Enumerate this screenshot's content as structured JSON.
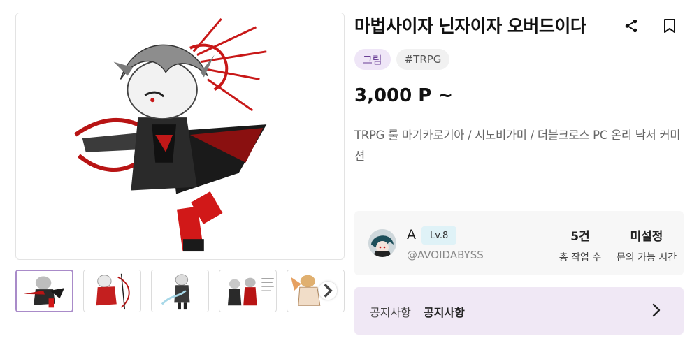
{
  "product": {
    "title": "마법사이자 닌자이자 오버드이다",
    "price": "3,000 P ~",
    "description": "TRPG 룰 마기카로기아 / 시노비가미 / 더블크로스 PC 온리 낙서 커미션",
    "tags": [
      {
        "label": "그림"
      },
      {
        "label": "#TRPG"
      }
    ]
  },
  "actions": {
    "share_icon": "share-icon",
    "bookmark_icon": "bookmark-icon"
  },
  "seller": {
    "name": "A",
    "level": "Lv.8",
    "handle": "@AVOIDABYSS",
    "stats": {
      "works_value": "5건",
      "works_label": "총 작업 수",
      "time_value": "미설정",
      "time_label": "문의 가능 시간"
    }
  },
  "notice": {
    "label": "공지사항",
    "text": "공지사항"
  },
  "colors": {
    "accent": "#6a3f96",
    "category_tag_bg": "#efe6f7",
    "notice_bg": "#f0e8f5",
    "level_badge_bg": "#dff2f7",
    "thumb_active_border": "#a98bc9"
  }
}
